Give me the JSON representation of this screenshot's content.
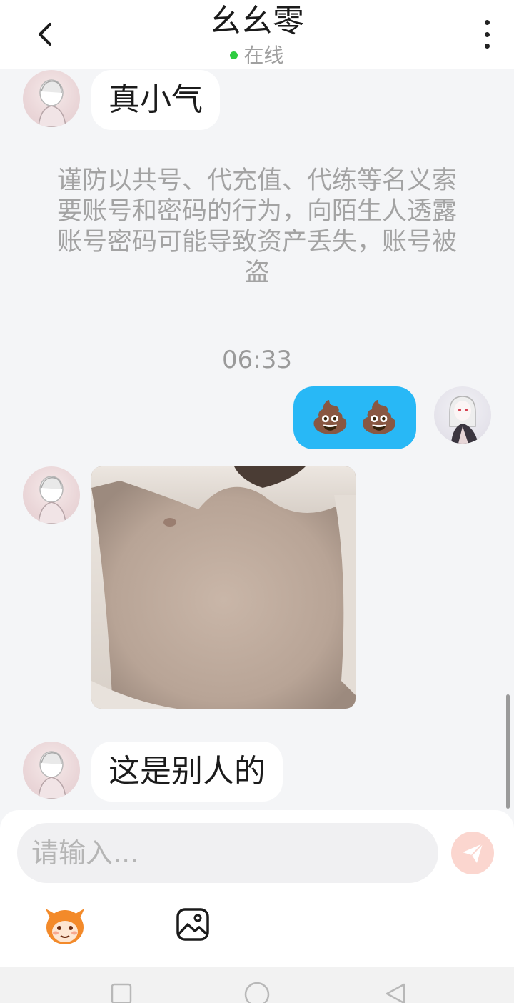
{
  "header": {
    "title": "幺幺零",
    "status": "在线",
    "back_icon": "chevron-left-icon",
    "more_icon": "more-vertical-icon",
    "status_color": "#2ecc40"
  },
  "messages": {
    "first_text": "真小气",
    "notice": "谨防以共号、代充值、代练等名义索要账号和密码的行为，向陌生人透露账号密码可能导致资产丢失，账号被盗",
    "time": "06:33",
    "self_emoji": "💩 💩",
    "photo_icon": "photo-image",
    "last_text": "这是别人的"
  },
  "composer": {
    "placeholder": "请输入...",
    "send_icon": "send-icon",
    "emoji_icon": "emoji-sticker-icon",
    "image_icon": "image-icon",
    "send_color": "#fbd6cf"
  },
  "navbar": {
    "recent_icon": "square-icon",
    "home_icon": "circle-icon",
    "back_icon": "triangle-back-icon"
  },
  "colors": {
    "self_bubble": "#28b8f6",
    "background": "#f4f5f7"
  }
}
